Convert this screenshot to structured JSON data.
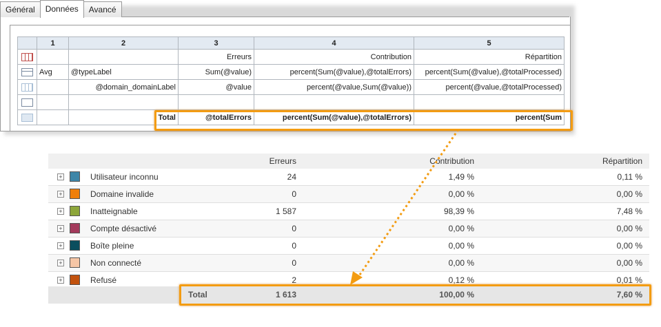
{
  "tabs": [
    "Général",
    "Données",
    "Avancé"
  ],
  "editor": {
    "columns": [
      "1",
      "2",
      "3",
      "4",
      "5"
    ],
    "rows": [
      {
        "icon": "header-row-icon",
        "c1": "",
        "c2": "",
        "c3": "Erreurs",
        "c4": "Contribution",
        "c5": "Répartition"
      },
      {
        "icon": "tree-row-icon",
        "c1": "Avg",
        "c2": "@typeLabel",
        "c3": "Sum(@value)",
        "c4": "percent(Sum(@value),@totalErrors)",
        "c5": "percent(Sum(@value),@totalProcessed)"
      },
      {
        "icon": "grid-row-icon",
        "c1": "",
        "c2": "@domain_domainLabel",
        "c3": "@value",
        "c4": "percent(@value,Sum(@value))",
        "c5": "percent(@value,@totalProcessed)"
      },
      {
        "icon": "add-row-icon",
        "c1": "",
        "c2": "",
        "c3": "",
        "c4": "",
        "c5": ""
      },
      {
        "icon": "footer-row-icon",
        "c1": "",
        "c2": "Total",
        "c3": "@totalErrors",
        "c4": "percent(Sum(@value),@totalErrors)",
        "c5": "percent(Sum"
      }
    ]
  },
  "result": {
    "headers": {
      "errors": "Erreurs",
      "contribution": "Contribution",
      "distribution": "Répartition"
    },
    "rows": [
      {
        "label": "Utilisateur inconnu",
        "color": "#3e86a8",
        "errors": "24",
        "contribution": "1,49 %",
        "distribution": "0,11 %"
      },
      {
        "label": "Domaine invalide",
        "color": "#f07f0a",
        "errors": "0",
        "contribution": "0,00 %",
        "distribution": "0,00 %"
      },
      {
        "label": "Inatteignable",
        "color": "#8da63a",
        "errors": "1 587",
        "contribution": "98,39 %",
        "distribution": "7,48 %"
      },
      {
        "label": "Compte désactivé",
        "color": "#a33a5c",
        "errors": "0",
        "contribution": "0,00 %",
        "distribution": "0,00 %"
      },
      {
        "label": "Boîte pleine",
        "color": "#0b4e5e",
        "errors": "0",
        "contribution": "0,00 %",
        "distribution": "0,00 %"
      },
      {
        "label": "Non connecté",
        "color": "#f6c6a6",
        "errors": "0",
        "contribution": "0,00 %",
        "distribution": "0,00 %"
      },
      {
        "label": "Refusé",
        "color": "#c2520e",
        "errors": "2",
        "contribution": "0,12 %",
        "distribution": "0,01 %"
      }
    ],
    "total": {
      "label": "Total",
      "errors": "1 613",
      "contribution": "100,00 %",
      "distribution": "7,60 %"
    }
  },
  "colors": {
    "highlight": "#f39c12",
    "header_bg": "#e3eaf2"
  }
}
